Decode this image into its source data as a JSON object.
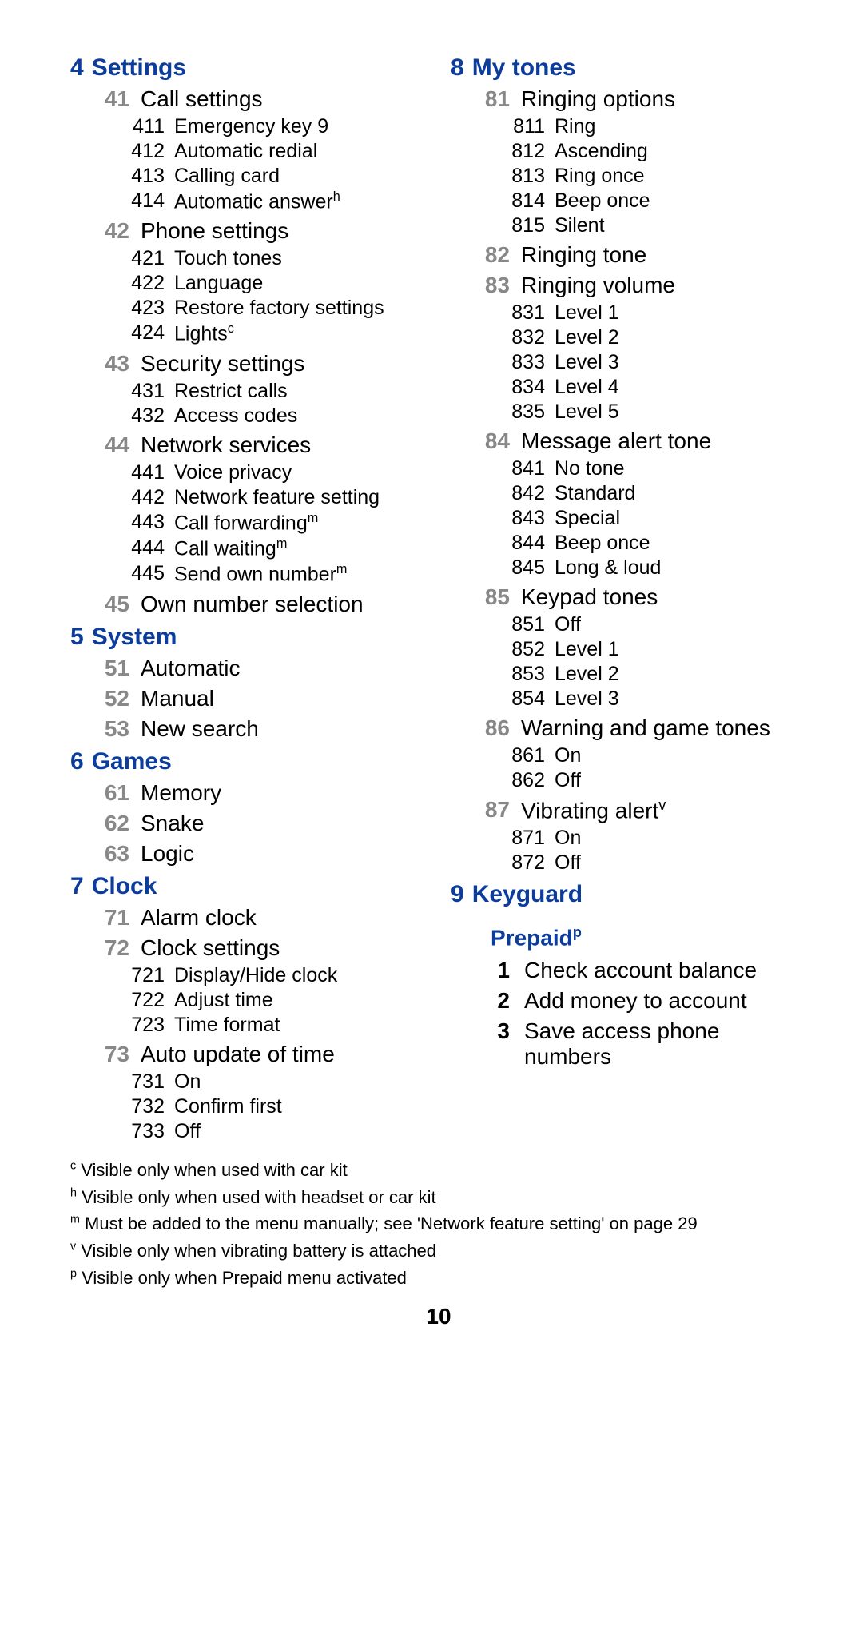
{
  "page_number": "10",
  "left": [
    {
      "t": "h1",
      "n": "4",
      "l": "Settings"
    },
    {
      "t": "h2",
      "n": "41",
      "l": "Call settings"
    },
    {
      "t": "h3",
      "n": "411",
      "l": "Emergency key 9"
    },
    {
      "t": "h3",
      "n": "412",
      "l": "Automatic redial"
    },
    {
      "t": "h3",
      "n": "413",
      "l": "Calling card"
    },
    {
      "t": "h3",
      "n": "414",
      "l": "Automatic answer",
      "sup": "h"
    },
    {
      "t": "h2",
      "n": "42",
      "l": "Phone settings"
    },
    {
      "t": "h3",
      "n": "421",
      "l": "Touch tones"
    },
    {
      "t": "h3",
      "n": "422",
      "l": "Language"
    },
    {
      "t": "h3",
      "n": "423",
      "l": "Restore factory settings"
    },
    {
      "t": "h3",
      "n": "424",
      "l": "Lights",
      "sup": "c"
    },
    {
      "t": "h2",
      "n": "43",
      "l": "Security settings"
    },
    {
      "t": "h3",
      "n": "431",
      "l": "Restrict calls"
    },
    {
      "t": "h3",
      "n": "432",
      "l": "Access codes"
    },
    {
      "t": "h2",
      "n": "44",
      "l": "Network services"
    },
    {
      "t": "h3",
      "n": "441",
      "l": "Voice privacy"
    },
    {
      "t": "h3",
      "n": "442",
      "l": "Network feature setting"
    },
    {
      "t": "h3",
      "n": "443",
      "l": "Call forwarding",
      "sup": "m"
    },
    {
      "t": "h3",
      "n": "444",
      "l": "Call waiting",
      "sup": "m"
    },
    {
      "t": "h3",
      "n": "445",
      "l": "Send own number",
      "sup": "m"
    },
    {
      "t": "h2",
      "n": "45",
      "l": "Own number selection"
    },
    {
      "t": "h1",
      "n": "5",
      "l": "System"
    },
    {
      "t": "h2",
      "n": "51",
      "l": "Automatic"
    },
    {
      "t": "h2",
      "n": "52",
      "l": "Manual"
    },
    {
      "t": "h2",
      "n": "53",
      "l": "New search"
    },
    {
      "t": "h1",
      "n": "6",
      "l": "Games"
    },
    {
      "t": "h2",
      "n": "61",
      "l": "Memory"
    },
    {
      "t": "h2",
      "n": "62",
      "l": "Snake"
    },
    {
      "t": "h2",
      "n": "63",
      "l": "Logic"
    },
    {
      "t": "h1",
      "n": "7",
      "l": "Clock"
    },
    {
      "t": "h2",
      "n": "71",
      "l": "Alarm clock"
    },
    {
      "t": "h2",
      "n": "72",
      "l": "Clock settings"
    },
    {
      "t": "h3",
      "n": "721",
      "l": "Display/Hide clock"
    },
    {
      "t": "h3",
      "n": "722",
      "l": "Adjust time"
    },
    {
      "t": "h3",
      "n": "723",
      "l": "Time format"
    },
    {
      "t": "h2",
      "n": "73",
      "l": "Auto update of time"
    },
    {
      "t": "h3",
      "n": "731",
      "l": "On"
    },
    {
      "t": "h3",
      "n": "732",
      "l": "Confirm first"
    },
    {
      "t": "h3",
      "n": "733",
      "l": "Off"
    }
  ],
  "right": [
    {
      "t": "h1",
      "n": "8",
      "l": "My tones"
    },
    {
      "t": "h2",
      "n": "81",
      "l": "Ringing options"
    },
    {
      "t": "h3",
      "n": "811",
      "l": "Ring"
    },
    {
      "t": "h3",
      "n": "812",
      "l": "Ascending"
    },
    {
      "t": "h3",
      "n": "813",
      "l": "Ring once"
    },
    {
      "t": "h3",
      "n": "814",
      "l": "Beep once"
    },
    {
      "t": "h3",
      "n": "815",
      "l": "Silent"
    },
    {
      "t": "h2",
      "n": "82",
      "l": "Ringing tone"
    },
    {
      "t": "h2",
      "n": "83",
      "l": "Ringing volume"
    },
    {
      "t": "h3",
      "n": "831",
      "l": "Level 1"
    },
    {
      "t": "h3",
      "n": "832",
      "l": "Level 2"
    },
    {
      "t": "h3",
      "n": "833",
      "l": "Level 3"
    },
    {
      "t": "h3",
      "n": "834",
      "l": "Level 4"
    },
    {
      "t": "h3",
      "n": "835",
      "l": "Level 5"
    },
    {
      "t": "h2",
      "n": "84",
      "l": "Message alert tone"
    },
    {
      "t": "h3",
      "n": "841",
      "l": "No tone"
    },
    {
      "t": "h3",
      "n": "842",
      "l": "Standard"
    },
    {
      "t": "h3",
      "n": "843",
      "l": "Special"
    },
    {
      "t": "h3",
      "n": "844",
      "l": "Beep once"
    },
    {
      "t": "h3",
      "n": "845",
      "l": "Long & loud"
    },
    {
      "t": "h2",
      "n": "85",
      "l": "Keypad tones"
    },
    {
      "t": "h3",
      "n": "851",
      "l": "Off"
    },
    {
      "t": "h3",
      "n": "852",
      "l": "Level 1"
    },
    {
      "t": "h3",
      "n": "853",
      "l": "Level 2"
    },
    {
      "t": "h3",
      "n": "854",
      "l": "Level 3"
    },
    {
      "t": "h2",
      "n": "86",
      "l": "Warning and game tones"
    },
    {
      "t": "h3",
      "n": "861",
      "l": "On"
    },
    {
      "t": "h3",
      "n": "862",
      "l": "Off"
    },
    {
      "t": "h2",
      "n": "87",
      "l": "Vibrating alert",
      "sup": "v"
    },
    {
      "t": "h3",
      "n": "871",
      "l": "On"
    },
    {
      "t": "h3",
      "n": "872",
      "l": "Off"
    },
    {
      "t": "h1",
      "n": "9",
      "l": "Keyguard"
    },
    {
      "t": "h1p",
      "l": "Prepaid",
      "sup": "p"
    },
    {
      "t": "p",
      "n": "1",
      "l": "Check account balance"
    },
    {
      "t": "p",
      "n": "2",
      "l": "Add money to account"
    },
    {
      "t": "p",
      "n": "3",
      "l": "Save access phone numbers"
    }
  ],
  "footnotes": [
    {
      "sup": "c",
      "text": "Visible only when used with car kit"
    },
    {
      "sup": "h",
      "text": "Visible only when used with headset or car kit"
    },
    {
      "sup": "m",
      "text": "Must be added to the menu manually; see 'Network feature setting' on page 29"
    },
    {
      "sup": "v",
      "text": "Visible only when vibrating battery is attached"
    },
    {
      "sup": "p",
      "text": "Visible only when Prepaid menu activated"
    }
  ]
}
